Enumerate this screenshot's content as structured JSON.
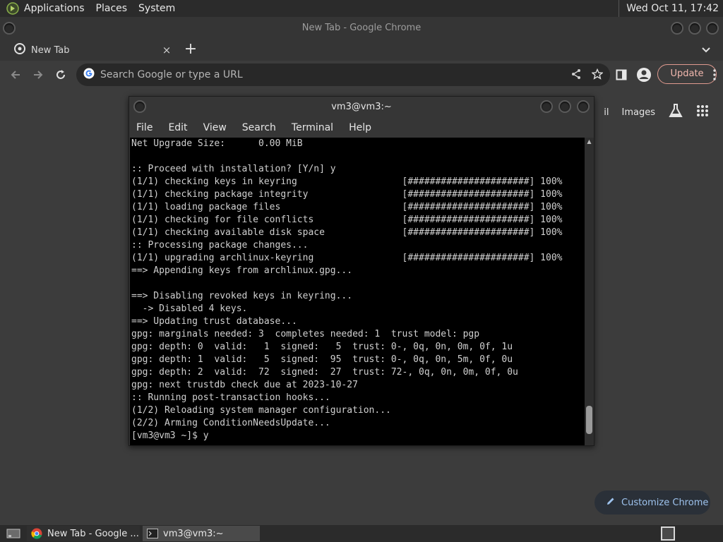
{
  "top_panel": {
    "menus": [
      "Applications",
      "Places",
      "System"
    ],
    "clock": "Wed Oct 11, 17:42"
  },
  "chrome": {
    "window_title": "New Tab - Google Chrome",
    "tab_title": "New Tab",
    "tab_close": "×",
    "new_tab": "+",
    "omnibox_placeholder": "Search Google or type a URL",
    "update_label": "Update",
    "ntp_mail_fragment": "il",
    "ntp_images": "Images",
    "customize_label": "Customize Chrome",
    "accent_color": "#9ec3ee",
    "update_color": "#f2b8ae"
  },
  "terminal": {
    "title": "vm3@vm3:~",
    "menu": [
      "File",
      "Edit",
      "View",
      "Search",
      "Terminal",
      "Help"
    ],
    "lines": [
      "Net Upgrade Size:      0.00 MiB",
      "",
      ":: Proceed with installation? [Y/n] y",
      "(1/1) checking keys in keyring                   [######################] 100%",
      "(1/1) checking package integrity                 [######################] 100%",
      "(1/1) loading package files                      [######################] 100%",
      "(1/1) checking for file conflicts                [######################] 100%",
      "(1/1) checking available disk space              [######################] 100%",
      ":: Processing package changes...",
      "(1/1) upgrading archlinux-keyring                [######################] 100%",
      "==> Appending keys from archlinux.gpg...",
      "",
      "==> Disabling revoked keys in keyring...",
      "  -> Disabled 4 keys.",
      "==> Updating trust database...",
      "gpg: marginals needed: 3  completes needed: 1  trust model: pgp",
      "gpg: depth: 0  valid:   1  signed:   5  trust: 0-, 0q, 0n, 0m, 0f, 1u",
      "gpg: depth: 1  valid:   5  signed:  95  trust: 0-, 0q, 0n, 5m, 0f, 0u",
      "gpg: depth: 2  valid:  72  signed:  27  trust: 72-, 0q, 0n, 0m, 0f, 0u",
      "gpg: next trustdb check due at 2023-10-27",
      ":: Running post-transaction hooks...",
      "(1/2) Reloading system manager configuration...",
      "(2/2) Arming ConditionNeedsUpdate...",
      "[vm3@vm3 ~]$ y"
    ]
  },
  "taskbar": {
    "tasks": [
      "New Tab - Google ...",
      "vm3@vm3:~"
    ]
  }
}
